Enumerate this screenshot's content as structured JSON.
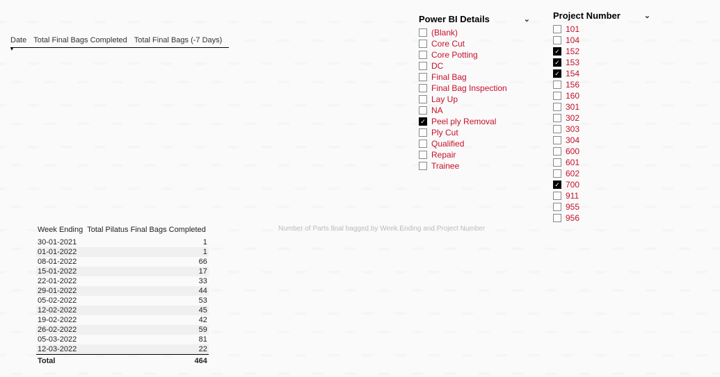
{
  "top_table": {
    "headers": [
      "Date",
      "Total Final Bags Completed",
      "Total Final Bags (-7 Days)"
    ],
    "sort_indicator": "▾"
  },
  "slicer_details": {
    "title": "Power BI Details",
    "items": [
      {
        "label": "(Blank)",
        "checked": false
      },
      {
        "label": "Core Cut",
        "checked": false
      },
      {
        "label": "Core Potting",
        "checked": false
      },
      {
        "label": "DC",
        "checked": false
      },
      {
        "label": "Final Bag",
        "checked": false
      },
      {
        "label": "Final Bag Inspection",
        "checked": false
      },
      {
        "label": "Lay Up",
        "checked": false
      },
      {
        "label": "NA",
        "checked": false
      },
      {
        "label": "Peel ply Removal",
        "checked": true
      },
      {
        "label": "Ply Cut",
        "checked": false
      },
      {
        "label": "Qualified",
        "checked": false
      },
      {
        "label": "Repair",
        "checked": false
      },
      {
        "label": "Trainee",
        "checked": false
      }
    ]
  },
  "slicer_project": {
    "title": "Project Number",
    "items": [
      {
        "label": "101",
        "checked": false
      },
      {
        "label": "104",
        "checked": false
      },
      {
        "label": "152",
        "checked": true
      },
      {
        "label": "153",
        "checked": true
      },
      {
        "label": "154",
        "checked": true
      },
      {
        "label": "156",
        "checked": false
      },
      {
        "label": "160",
        "checked": false
      },
      {
        "label": "301",
        "checked": false
      },
      {
        "label": "302",
        "checked": false
      },
      {
        "label": "303",
        "checked": false
      },
      {
        "label": "304",
        "checked": false
      },
      {
        "label": "600",
        "checked": false
      },
      {
        "label": "601",
        "checked": false
      },
      {
        "label": "602",
        "checked": false
      },
      {
        "label": "700",
        "checked": true
      },
      {
        "label": "911",
        "checked": false
      },
      {
        "label": "955",
        "checked": false
      },
      {
        "label": "956",
        "checked": false
      }
    ]
  },
  "chart_placeholder": {
    "text": "Number of Parts final bagged by Week Ending and Project Number"
  },
  "bottom_table": {
    "headers": [
      "Week Ending",
      "Total Pilatus Final Bags Completed"
    ],
    "rows": [
      {
        "week": "30-01-2021",
        "value": 1
      },
      {
        "week": "01-01-2022",
        "value": 1
      },
      {
        "week": "08-01-2022",
        "value": 66
      },
      {
        "week": "15-01-2022",
        "value": 17
      },
      {
        "week": "22-01-2022",
        "value": 33
      },
      {
        "week": "29-01-2022",
        "value": 44
      },
      {
        "week": "05-02-2022",
        "value": 53
      },
      {
        "week": "12-02-2022",
        "value": 45
      },
      {
        "week": "19-02-2022",
        "value": 42
      },
      {
        "week": "26-02-2022",
        "value": 59
      },
      {
        "week": "05-03-2022",
        "value": 81
      },
      {
        "week": "12-03-2022",
        "value": 22
      }
    ],
    "total_label": "Total",
    "total_value": 464
  }
}
